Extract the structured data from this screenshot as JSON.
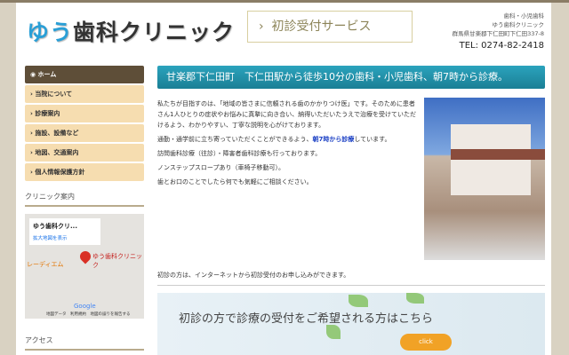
{
  "header": {
    "logo_accent": "ゆう",
    "logo_rest": "歯科クリニック",
    "service_button": "初診受付サービス",
    "info": [
      "歯科・小児歯科",
      "ゆう歯科クリニック",
      "群馬県甘楽郡下仁田町下仁田337-8"
    ],
    "tel": "TEL: 0274-82-2418"
  },
  "nav": [
    "ホーム",
    "当院について",
    "診療案内",
    "施設、設備など",
    "地図、交通案内",
    "個人情報保護方針"
  ],
  "sidebar": {
    "clinic_heading": "クリニック案内",
    "access_heading": "アクセス",
    "map": {
      "card_title": "ゆう歯科クリ...",
      "card_link": "拡大地図を表示",
      "place": "ゆう歯科クリニック",
      "poi": "レーディエム",
      "google": "Google",
      "footer": "地図データ　利用規約　地図の誤りを報告する"
    }
  },
  "main": {
    "title": "甘楽郡下仁田町　下仁田駅から徒歩10分の歯科・小児歯科、朝7時から診療。",
    "p1": "私たちが目指すのは、「地域の皆さまに信頼される歯のかかりつけ医」です。そのために患者さん1人ひとりの症状やお悩みに真摯に向き合い、納得いただいたうえで治療を受けていただけるよう、わかりやすい、丁寧な説明を心がけております。",
    "p2a": "通勤・通学前に立ち寄っていただくことができるよう、",
    "p2b": "朝7時から診療",
    "p2c": "しています。",
    "p3": "訪問歯科診療（往診）・障害者歯科診療も行っております。",
    "p4": "ノンステップスロープあり（車椅子移動可）。",
    "p5": "歯とお口のことでしたら何でも気軽にご相談ください。",
    "lead": "初診の方は、インターネットから初診受付のお申し込みができます。",
    "banner_text": "初診の方で診療の受付をご希望される方はこちら",
    "click": "click"
  }
}
